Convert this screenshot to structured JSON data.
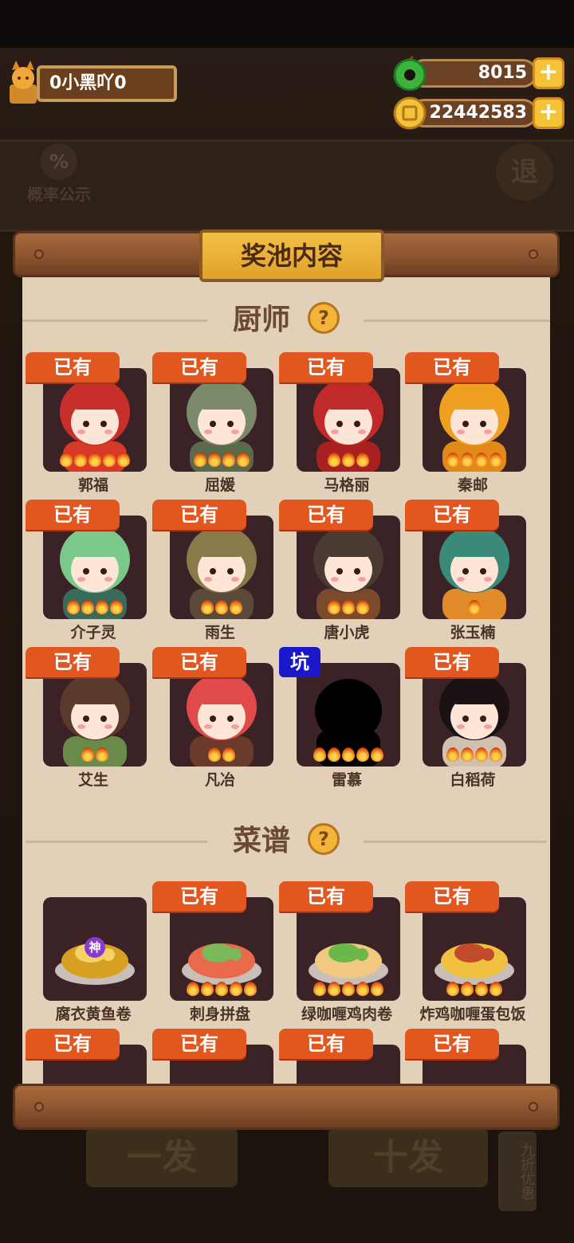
{
  "player": {
    "name": "0小黑吖0"
  },
  "resources": [
    {
      "icon": "jade-coin-icon",
      "value": "8015"
    },
    {
      "icon": "gold-coin-icon",
      "value": "22442583"
    }
  ],
  "background": {
    "probability_label": "概率公示",
    "back_label": "退",
    "single_draw": "一发",
    "ten_draw": "十发",
    "discount_tag": "九折优惠"
  },
  "panel": {
    "title": "奖池内容"
  },
  "chef_section": {
    "title": "厨师",
    "items": [
      {
        "name": "郭福",
        "badge": "已有",
        "stars": 5
      },
      {
        "name": "屈媛",
        "badge": "已有",
        "stars": 4
      },
      {
        "name": "马格丽",
        "badge": "已有",
        "stars": 3
      },
      {
        "name": "秦邮",
        "badge": "已有",
        "stars": 4
      },
      {
        "name": "介子灵",
        "badge": "已有",
        "stars": 4
      },
      {
        "name": "雨生",
        "badge": "已有",
        "stars": 3
      },
      {
        "name": "唐小虎",
        "badge": "已有",
        "stars": 3
      },
      {
        "name": "张玉楠",
        "badge": "已有",
        "stars": 1
      },
      {
        "name": "艾生",
        "badge": "已有",
        "stars": 2
      },
      {
        "name": "凡冶",
        "badge": "已有",
        "stars": 2
      },
      {
        "name": "雷慕",
        "badge": "坑",
        "stars": 5
      },
      {
        "name": "白稻荷",
        "badge": "已有",
        "stars": 4
      }
    ]
  },
  "recipe_section": {
    "title": "菜谱",
    "items": [
      {
        "name": "腐衣黄鱼卷",
        "badge": "",
        "stars": 0,
        "tag": "神"
      },
      {
        "name": "刺身拼盘",
        "badge": "已有",
        "stars": 5
      },
      {
        "name": "绿咖喱鸡肉卷",
        "badge": "已有",
        "stars": 5
      },
      {
        "name": "炸鸡咖喱蛋包饭",
        "badge": "已有",
        "stars": 4
      },
      {
        "name": "",
        "badge": "已有",
        "stars": 0
      },
      {
        "name": "",
        "badge": "已有",
        "stars": 0
      },
      {
        "name": "",
        "badge": "已有",
        "stars": 0
      },
      {
        "name": "",
        "badge": "已有",
        "stars": 0
      }
    ]
  },
  "colors": {
    "badge": "#e2561f",
    "pit_badge": "#1a18c9",
    "panel": "#e2d0b8",
    "card": "#3b2226"
  }
}
